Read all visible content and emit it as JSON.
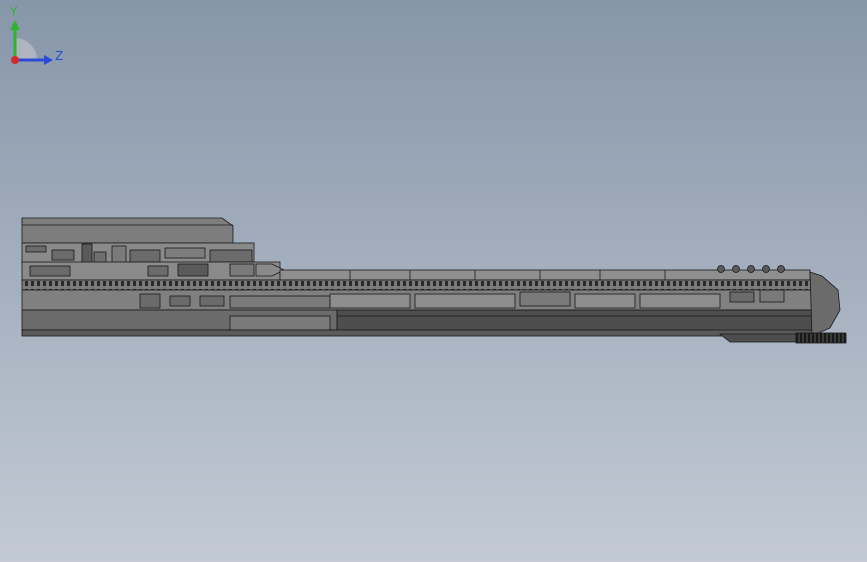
{
  "viewport": {
    "background_top": "#8796a9",
    "background_bottom": "#c3cad5",
    "model_fill_dark": "#4d4d4d",
    "model_fill_mid": "#6b6b6b",
    "model_fill_light": "#8a8a8a",
    "model_edge": "#1a1a1a"
  },
  "triad": {
    "y_label": "Y",
    "z_label": "Z",
    "y_color": "#2db52d",
    "z_color": "#2a4bd8",
    "x_color": "#d42a2a"
  }
}
